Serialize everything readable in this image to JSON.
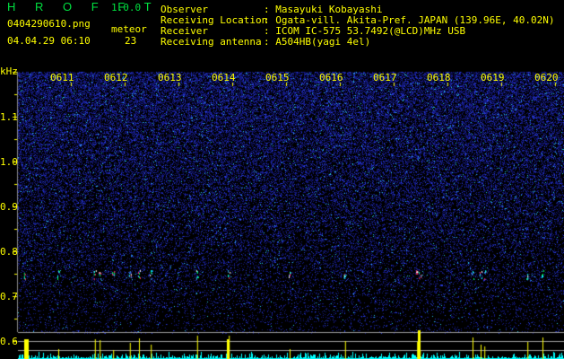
{
  "header": {
    "app_name": "H R O F F T",
    "version": "1.0.0",
    "filename": "0404290610.png",
    "datetime": "04.04.29 06:10",
    "meteor_label": "meteor",
    "meteor_count": "23"
  },
  "info": [
    {
      "label": "Observer",
      "value": "Masayuki Kobayashi"
    },
    {
      "label": "Receiving Location",
      "value": "Ogata-vill. Akita-Pref. JAPAN (139.96E, 40.02N)"
    },
    {
      "label": "Receiver",
      "value": "ICOM IC-575 53.7492(@LCD)MHz USB"
    },
    {
      "label": "Receiving antenna",
      "value": "A504HB(yagi 4el)"
    }
  ],
  "colors": {
    "text": "#ffff00",
    "title": "#00e040",
    "background": "#000000",
    "noise": "#1a2aa0",
    "histogram": "#00ffff",
    "meteor_bar": "#ffff00"
  },
  "chart_data": {
    "type": "heatmap",
    "ylabel": "kHz",
    "y_ticks": [
      "1.1",
      "1.0",
      "0.9",
      "0.8",
      "0.7",
      "0.6"
    ],
    "x_ticks": [
      "0611",
      "0612",
      "0613",
      "0614",
      "0615",
      "0616",
      "0617",
      "0618",
      "0619",
      "0620"
    ],
    "x_range": [
      "06:10",
      "06:20"
    ],
    "y_range_khz": [
      0.58,
      1.2
    ],
    "meteor_echo_freq_khz": 0.75,
    "meteor_echo_times_min": [
      10.13,
      10.75,
      11.43,
      11.52,
      11.77,
      12.08,
      12.25,
      12.47,
      13.33,
      13.92,
      15.05,
      16.08,
      17.42,
      17.47,
      18.45,
      18.6,
      18.67,
      19.47,
      19.75
    ]
  }
}
